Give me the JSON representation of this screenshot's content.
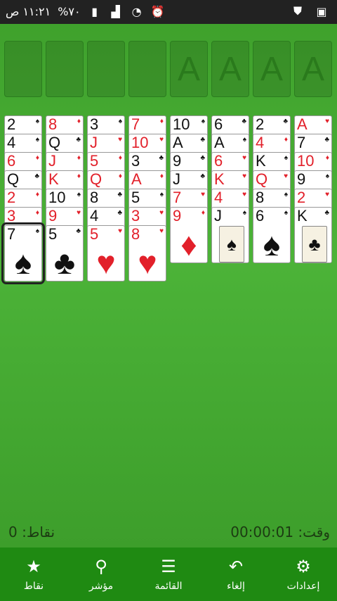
{
  "status_bar": {
    "time": "١١:٢١ ص",
    "battery": "%٧٠",
    "icons": [
      "signal-icon",
      "wifi-icon",
      "alarm-icon",
      "shield-icon",
      "image-icon"
    ]
  },
  "foundations_label": "A",
  "tableau": [
    [
      {
        "rank": "2",
        "suit": "♠",
        "color": "black"
      },
      {
        "rank": "4",
        "suit": "♠",
        "color": "black"
      },
      {
        "rank": "6",
        "suit": "♦",
        "color": "red"
      },
      {
        "rank": "Q",
        "suit": "♣",
        "color": "black"
      },
      {
        "rank": "2",
        "suit": "♦",
        "color": "red"
      },
      {
        "rank": "3",
        "suit": "♦",
        "color": "red"
      },
      {
        "rank": "7",
        "suit": "♠",
        "color": "black",
        "selected": true
      }
    ],
    [
      {
        "rank": "8",
        "suit": "♦",
        "color": "red"
      },
      {
        "rank": "Q",
        "suit": "♣",
        "color": "black"
      },
      {
        "rank": "J",
        "suit": "♦",
        "color": "red"
      },
      {
        "rank": "K",
        "suit": "♦",
        "color": "red"
      },
      {
        "rank": "10",
        "suit": "♠",
        "color": "black"
      },
      {
        "rank": "9",
        "suit": "♥",
        "color": "red"
      },
      {
        "rank": "5",
        "suit": "♣",
        "color": "black"
      }
    ],
    [
      {
        "rank": "3",
        "suit": "♠",
        "color": "black"
      },
      {
        "rank": "J",
        "suit": "♥",
        "color": "red"
      },
      {
        "rank": "5",
        "suit": "♦",
        "color": "red"
      },
      {
        "rank": "Q",
        "suit": "♦",
        "color": "red"
      },
      {
        "rank": "8",
        "suit": "♣",
        "color": "black"
      },
      {
        "rank": "4",
        "suit": "♣",
        "color": "black"
      },
      {
        "rank": "5",
        "suit": "♥",
        "color": "red"
      }
    ],
    [
      {
        "rank": "7",
        "suit": "♦",
        "color": "red"
      },
      {
        "rank": "10",
        "suit": "♥",
        "color": "red"
      },
      {
        "rank": "3",
        "suit": "♣",
        "color": "black"
      },
      {
        "rank": "A",
        "suit": "♦",
        "color": "red"
      },
      {
        "rank": "5",
        "suit": "♠",
        "color": "black"
      },
      {
        "rank": "3",
        "suit": "♥",
        "color": "red"
      },
      {
        "rank": "8",
        "suit": "♥",
        "color": "red"
      }
    ],
    [
      {
        "rank": "10",
        "suit": "♠",
        "color": "black"
      },
      {
        "rank": "A",
        "suit": "♣",
        "color": "black"
      },
      {
        "rank": "9",
        "suit": "♣",
        "color": "black"
      },
      {
        "rank": "J",
        "suit": "♣",
        "color": "black"
      },
      {
        "rank": "7",
        "suit": "♥",
        "color": "red"
      },
      {
        "rank": "9",
        "suit": "♦",
        "color": "red"
      }
    ],
    [
      {
        "rank": "6",
        "suit": "♣",
        "color": "black"
      },
      {
        "rank": "A",
        "suit": "♠",
        "color": "black"
      },
      {
        "rank": "6",
        "suit": "♥",
        "color": "red"
      },
      {
        "rank": "K",
        "suit": "♥",
        "color": "red"
      },
      {
        "rank": "4",
        "suit": "♥",
        "color": "red"
      },
      {
        "rank": "J",
        "suit": "♠",
        "color": "black",
        "face": true
      }
    ],
    [
      {
        "rank": "2",
        "suit": "♣",
        "color": "black"
      },
      {
        "rank": "4",
        "suit": "♦",
        "color": "red"
      },
      {
        "rank": "K",
        "suit": "♠",
        "color": "black"
      },
      {
        "rank": "Q",
        "suit": "♥",
        "color": "red"
      },
      {
        "rank": "8",
        "suit": "♠",
        "color": "black"
      },
      {
        "rank": "6",
        "suit": "♠",
        "color": "black"
      }
    ],
    [
      {
        "rank": "A",
        "suit": "♥",
        "color": "red"
      },
      {
        "rank": "7",
        "suit": "♣",
        "color": "black"
      },
      {
        "rank": "10",
        "suit": "♦",
        "color": "red"
      },
      {
        "rank": "9",
        "suit": "♠",
        "color": "black"
      },
      {
        "rank": "2",
        "suit": "♥",
        "color": "red"
      },
      {
        "rank": "K",
        "suit": "♣",
        "color": "black",
        "face": true
      }
    ]
  ],
  "score_label": "نقاط: 0",
  "time_label": "وقت: 00:00:01",
  "bottom_nav": [
    {
      "label": "نقاط",
      "icon": "★"
    },
    {
      "label": "مؤشر",
      "icon": "⚲"
    },
    {
      "label": "القائمة",
      "icon": "☰"
    },
    {
      "label": "إلغاء",
      "icon": "↶"
    },
    {
      "label": "إعدادات",
      "icon": "⚙"
    }
  ]
}
